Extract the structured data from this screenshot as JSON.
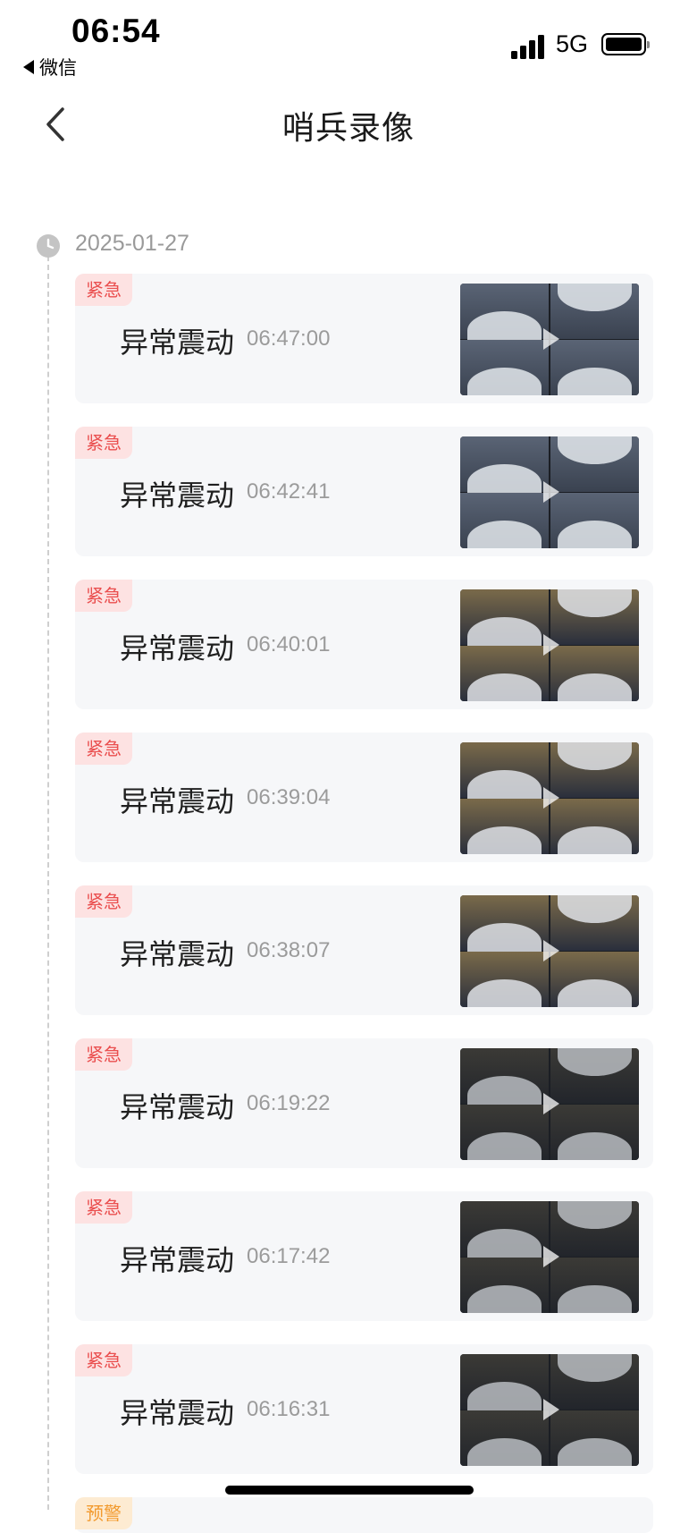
{
  "status_bar": {
    "time": "06:54",
    "back_app": "微信",
    "network": "5G"
  },
  "nav": {
    "title": "哨兵录像"
  },
  "timeline": {
    "date": "2025-01-27",
    "events": [
      {
        "tag": "紧急",
        "title": "异常震动",
        "time": "06:47:00",
        "tone": "snow"
      },
      {
        "tag": "紧急",
        "title": "异常震动",
        "time": "06:42:41",
        "tone": "snow"
      },
      {
        "tag": "紧急",
        "title": "异常震动",
        "time": "06:40:01",
        "tone": "dusk"
      },
      {
        "tag": "紧急",
        "title": "异常震动",
        "time": "06:39:04",
        "tone": "dusk"
      },
      {
        "tag": "紧急",
        "title": "异常震动",
        "time": "06:38:07",
        "tone": "dusk"
      },
      {
        "tag": "紧急",
        "title": "异常震动",
        "time": "06:19:22",
        "tone": "night"
      },
      {
        "tag": "紧急",
        "title": "异常震动",
        "time": "06:17:42",
        "tone": "night"
      },
      {
        "tag": "紧急",
        "title": "异常震动",
        "time": "06:16:31",
        "tone": "night"
      }
    ],
    "partial_event": {
      "tag": "预警"
    }
  },
  "colors": {
    "urgent_bg": "#fde2e2",
    "urgent_text": "#ea4f4f",
    "warn_bg": "#fdebd2",
    "warn_text": "#f29a2e",
    "card_bg": "#f6f7f9"
  }
}
